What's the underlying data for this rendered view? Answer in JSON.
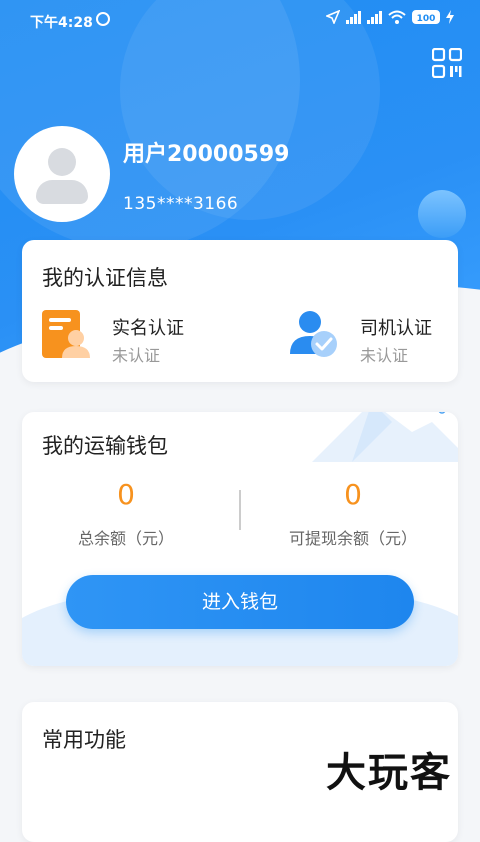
{
  "status_bar": {
    "time": "下午4:28",
    "battery": "100"
  },
  "profile": {
    "username": "用户20000599",
    "phone": "135****3166"
  },
  "auth_card": {
    "title": "我的认证信息",
    "items": [
      {
        "label": "实名认证",
        "status": "未认证",
        "icon": "id-card-icon"
      },
      {
        "label": "司机认证",
        "status": "未认证",
        "icon": "driver-verified-icon"
      }
    ]
  },
  "wallet_card": {
    "title": "我的运输钱包",
    "total_balance": {
      "value": "0",
      "caption": "总余额（元）"
    },
    "withdrawable": {
      "value": "0",
      "caption": "可提现余额（元）"
    },
    "button_label": "进入钱包"
  },
  "common_card": {
    "title": "常用功能"
  },
  "watermark": "大玩客",
  "colors": {
    "primary": "#1f8df2",
    "accent_orange": "#f7921e",
    "background": "#f4f6f9"
  }
}
